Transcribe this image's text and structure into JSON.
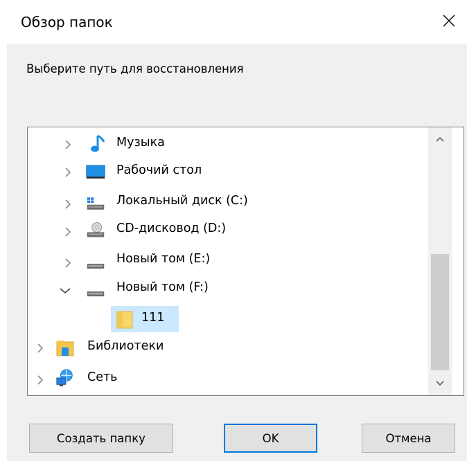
{
  "window": {
    "title": "Обзор папок",
    "close_icon": "close-icon"
  },
  "instruction": "Выберите путь для восстановления",
  "tree": {
    "items": [
      {
        "label": "Музыка",
        "icon": "music-note-icon",
        "expanded": false
      },
      {
        "label": "Рабочий стол",
        "icon": "desktop-icon",
        "expanded": false
      },
      {
        "label": "Локальный диск (C:)",
        "icon": "local-disk-icon",
        "expanded": false
      },
      {
        "label": "CD-дисковод (D:)",
        "icon": "cd-drive-icon",
        "expanded": false
      },
      {
        "label": "Новый том (E:)",
        "icon": "drive-icon",
        "expanded": false
      },
      {
        "label": "Новый том (F:)",
        "icon": "drive-icon",
        "expanded": true
      },
      {
        "label": "111",
        "icon": "folder-icon",
        "selected": true
      },
      {
        "label": "Библиотеки",
        "icon": "libraries-icon",
        "expanded": false
      },
      {
        "label": "Сеть",
        "icon": "network-icon",
        "expanded": false
      }
    ]
  },
  "buttons": {
    "new_folder": "Создать папку",
    "ok": "OK",
    "cancel": "Отмена"
  },
  "colors": {
    "selection": "#cce8ff",
    "default_button_border": "#0078d7",
    "dialog_background": "#f0f0f0"
  }
}
